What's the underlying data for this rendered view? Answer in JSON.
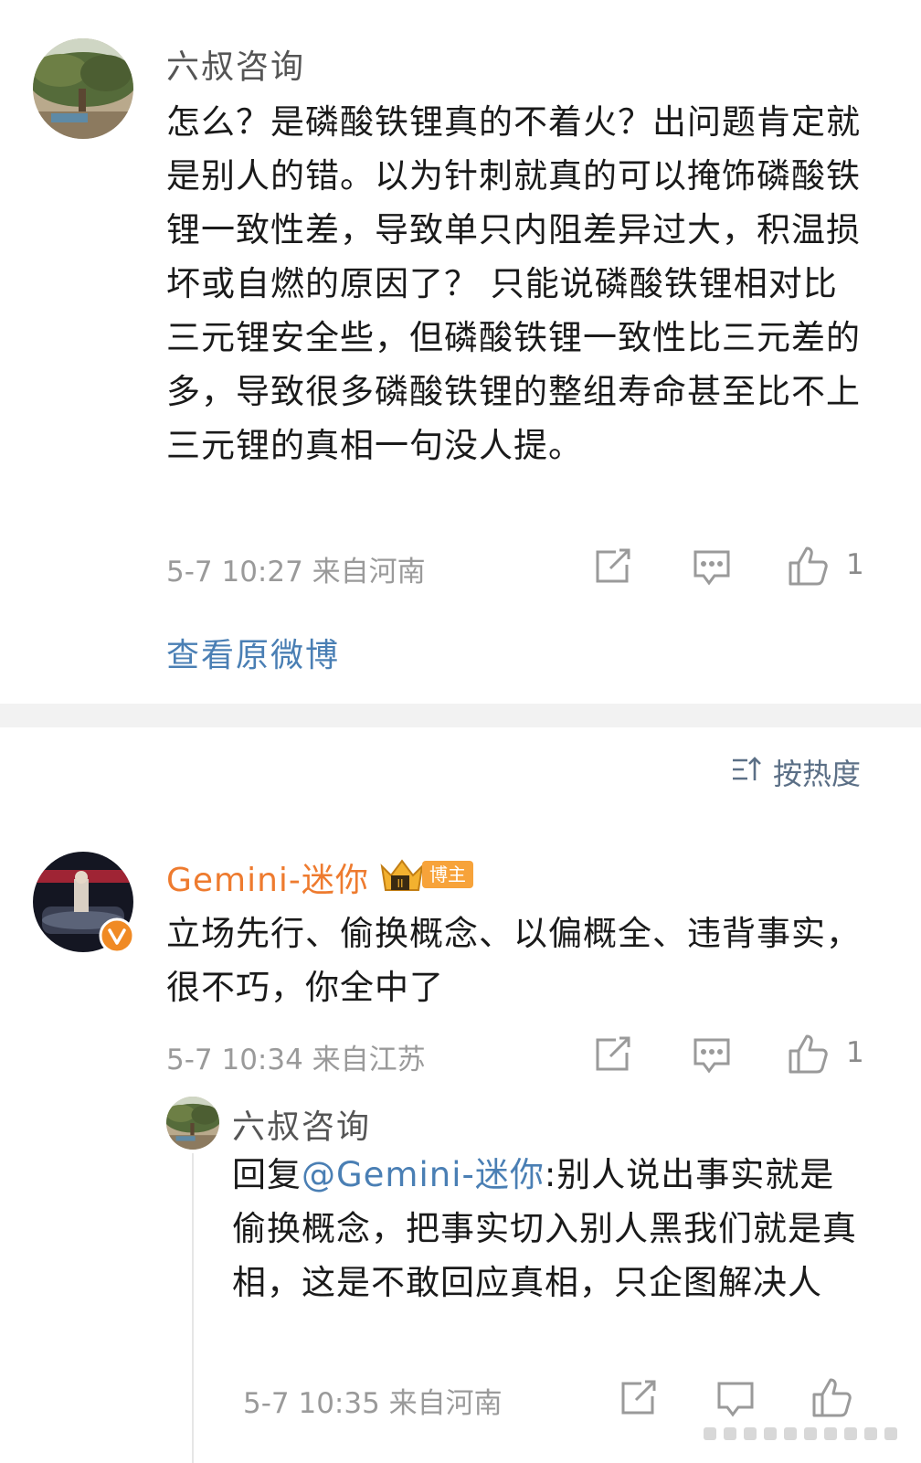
{
  "post": {
    "author": "六叔咨询",
    "text": "怎么？是磷酸铁锂真的不着火？出问题肯定就是别人的错。以为针刺就真的可以掩饰磷酸铁锂一致性差，导致单只内阻差异过大，积温损坏或自燃的原因了？ 只能说磷酸铁锂相对比三元锂安全些，但磷酸铁锂一致性比三元差的多，导致很多磷酸铁锂的整组寿命甚至比不上三元锂的真相一句没人提。",
    "meta": "5-7 10:27 来自河南",
    "likes": "1",
    "view_original": "查看原微博"
  },
  "sort_label": "按热度",
  "comment": {
    "author": "Gemini-迷你",
    "badge": "博主",
    "text": "立场先行、偷换概念、以偏概全、违背事实，很不巧，你全中了",
    "meta": "5-7 10:34 来自江苏",
    "likes": "1"
  },
  "reply": {
    "author": "六叔咨询",
    "prefix": "回复",
    "mention": "@Gemini-迷你",
    "text": ":别人说出事实就是偷换概念，把事实切入别人黑我们就是真相，这是不敢回应真相，只企图解决人",
    "meta": "5-7 10:35 来自河南"
  },
  "colors": {
    "accent_blue": "#4a7fb4",
    "username_orange": "#ee7b2f",
    "verified_orange": "#f08a24"
  }
}
